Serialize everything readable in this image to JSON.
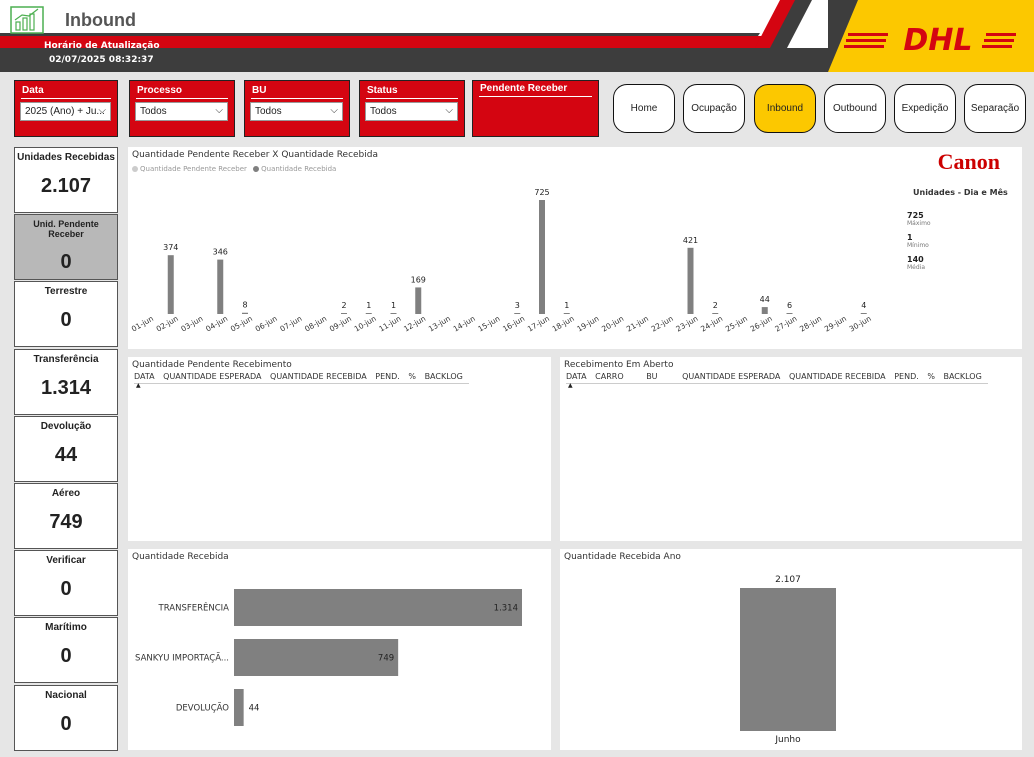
{
  "header": {
    "title": "Inbound",
    "update_label": "Horário de Atualização",
    "update_value": "02/07/2025 08:32:37",
    "logo_text": "DHL"
  },
  "filters": [
    {
      "label": "Data",
      "value": "2025 (Ano) + Ju..."
    },
    {
      "label": "Processo",
      "value": "Todos"
    },
    {
      "label": "BU",
      "value": "Todos"
    },
    {
      "label": "Status",
      "value": "Todos"
    },
    {
      "label": "Pendente Receber",
      "value": ""
    }
  ],
  "nav": [
    {
      "label": "Home",
      "active": false
    },
    {
      "label": "Ocupação",
      "active": false
    },
    {
      "label": "Inbound",
      "active": true
    },
    {
      "label": "Outbound",
      "active": false
    },
    {
      "label": "Expedição",
      "active": false
    },
    {
      "label": "Separação",
      "active": false
    }
  ],
  "kpis": [
    {
      "label": "Unidades Recebidas",
      "value": "2.107"
    },
    {
      "label": "Unid. Pendente Receber",
      "value": "0"
    },
    {
      "label": "Terrestre",
      "value": "0"
    },
    {
      "label": "Transferência",
      "value": "1.314"
    },
    {
      "label": "Devolução",
      "value": "44"
    },
    {
      "label": "Aéreo",
      "value": "749"
    },
    {
      "label": "Verificar",
      "value": "0"
    },
    {
      "label": "Marítimo",
      "value": "0"
    },
    {
      "label": "Nacional",
      "value": "0"
    }
  ],
  "daily_panel": {
    "title": "Quantidade Pendente Receber X Quantidade Recebida",
    "legend": [
      "Quantidade Pendente Receber",
      "Quantidade Recebida"
    ],
    "brand": "Canon",
    "stats_title": "Unidades - Dia e Mês",
    "stats": [
      {
        "value": "725",
        "label": "Máximo"
      },
      {
        "value": "1",
        "label": "Mínimo"
      },
      {
        "value": "140",
        "label": "Média"
      }
    ]
  },
  "pending_table": {
    "title": "Quantidade Pendente Recebimento",
    "columns": [
      "DATA",
      "QUANTIDADE ESPERADA",
      "QUANTIDADE RECEBIDA",
      "PEND.",
      "%",
      "BACKLOG"
    ]
  },
  "open_table": {
    "title": "Recebimento Em Aberto",
    "columns": [
      "DATA",
      "CARRO",
      "BU",
      "QUANTIDADE ESPERADA",
      "QUANTIDADE RECEBIDA",
      "PEND.",
      "%",
      "BACKLOG"
    ]
  },
  "received_panel": {
    "title": "Quantidade Recebida"
  },
  "year_panel": {
    "title": "Quantidade Recebida Ano"
  },
  "colors": {
    "red": "#d40511",
    "yellow": "#fcc800",
    "bar": "#808080",
    "dark": "#3d3d3d"
  },
  "chart_data": [
    {
      "type": "bar",
      "categories": [
        "01-jun",
        "02-jun",
        "03-jun",
        "04-jun",
        "05-jun",
        "06-jun",
        "07-jun",
        "08-jun",
        "09-jun",
        "10-jun",
        "11-jun",
        "12-jun",
        "13-jun",
        "14-jun",
        "15-jun",
        "16-jun",
        "17-jun",
        "18-jun",
        "19-jun",
        "20-jun",
        "21-jun",
        "22-jun",
        "23-jun",
        "24-jun",
        "25-jun",
        "26-jun",
        "27-jun",
        "28-jun",
        "29-jun",
        "30-jun"
      ],
      "series": [
        {
          "name": "Quantidade Recebida",
          "values": [
            null,
            374,
            null,
            346,
            8,
            null,
            null,
            null,
            2,
            1,
            1,
            169,
            null,
            null,
            null,
            3,
            725,
            1,
            null,
            null,
            null,
            null,
            421,
            2,
            null,
            44,
            6,
            null,
            null,
            4
          ]
        }
      ]
    },
    {
      "type": "bar",
      "orientation": "horizontal",
      "categories": [
        "TRANSFERÊNCIA",
        "SANKYU IMPORTAÇÃ...",
        "DEVOLUÇÃO"
      ],
      "values": [
        1314,
        749,
        44
      ],
      "labels": [
        "1.314",
        "749",
        "44"
      ]
    },
    {
      "type": "bar",
      "categories": [
        "Junho"
      ],
      "values": [
        2107
      ],
      "labels": [
        "2.107"
      ]
    }
  ]
}
